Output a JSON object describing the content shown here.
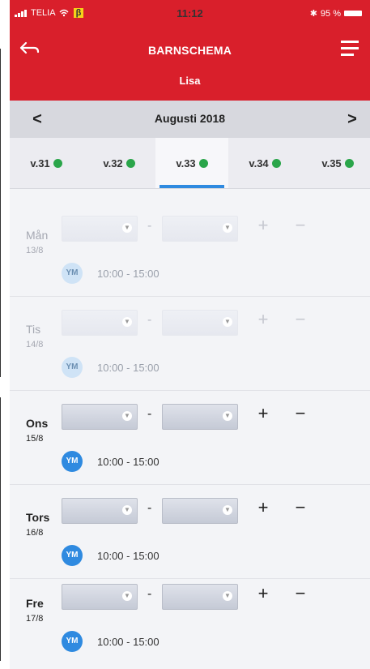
{
  "status_bar": {
    "carrier": "TELIA",
    "beta_badge": "β",
    "time": "11:12",
    "battery_text": "95 %"
  },
  "header": {
    "title": "BARNSCHEMA",
    "child_name": "Lisa",
    "bg_color": "#d91f2b"
  },
  "month_nav": {
    "prev": "<",
    "label": "Augusti 2018",
    "next": ">"
  },
  "weeks": [
    {
      "label": "v.31",
      "status": "ok"
    },
    {
      "label": "v.32",
      "status": "ok"
    },
    {
      "label": "v.33",
      "status": "ok",
      "active": true
    },
    {
      "label": "v.34",
      "status": "ok"
    },
    {
      "label": "v.35",
      "status": "ok"
    }
  ],
  "days": [
    {
      "name": "Mån",
      "date": "13/8",
      "initials": "YM",
      "time": "10:00 - 15:00",
      "enabled": false
    },
    {
      "name": "Tis",
      "date": "14/8",
      "initials": "YM",
      "time": "10:00 - 15:00",
      "enabled": false
    },
    {
      "name": "Ons",
      "date": "15/8",
      "initials": "YM",
      "time": "10:00 - 15:00",
      "enabled": true
    },
    {
      "name": "Tors",
      "date": "16/8",
      "initials": "YM",
      "time": "10:00 - 15:00",
      "enabled": true
    },
    {
      "name": "Fre",
      "date": "17/8",
      "initials": "YM",
      "time": "10:00 - 15:00",
      "enabled": true
    }
  ],
  "controls": {
    "dash": "-",
    "plus": "+",
    "minus": "−"
  },
  "colors": {
    "accent_blue": "#2f8ae0",
    "status_green": "#2aa54a"
  }
}
